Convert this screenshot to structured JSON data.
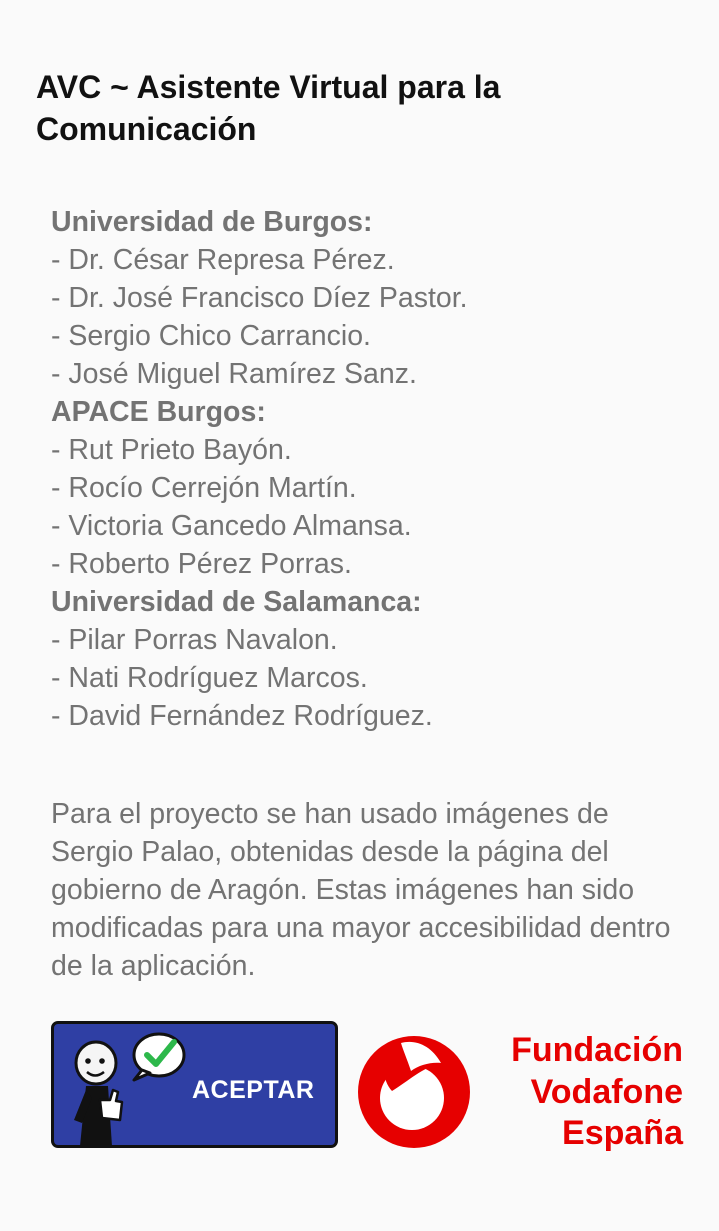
{
  "title": "AVC ~ Asistente Virtual para la Comunicación",
  "credits": [
    {
      "org": "Universidad de Burgos:",
      "people": [
        "- Dr. César Represa Pérez.",
        "- Dr. José Francisco Díez Pastor.",
        "- Sergio Chico Carrancio.",
        "- José Miguel Ramírez Sanz."
      ]
    },
    {
      "org": "APACE Burgos:",
      "people": [
        "- Rut Prieto Bayón.",
        "- Rocío Cerrejón Martín.",
        "- Victoria Gancedo Almansa.",
        "- Roberto Pérez Porras."
      ]
    },
    {
      "org": "Universidad de Salamanca:",
      "people": [
        "- Pilar Porras Navalon.",
        "- Nati Rodríguez Marcos.",
        "- David Fernández Rodríguez."
      ]
    }
  ],
  "note": "Para el proyecto se han usado imágenes de Sergio Palao, obtenidas desde la página del gobierno de Aragón. Estas imágenes han sido modificadas para una mayor accesibilidad dentro de la aplicación.",
  "accept_button": {
    "label": "ACEPTAR",
    "icon": "thumbs-up-person-icon",
    "bg_color": "#2f3fa4"
  },
  "sponsor": {
    "lines": [
      "Fundación",
      "Vodafone",
      "España"
    ],
    "logo": "vodafone-logo",
    "color": "#e60000"
  }
}
